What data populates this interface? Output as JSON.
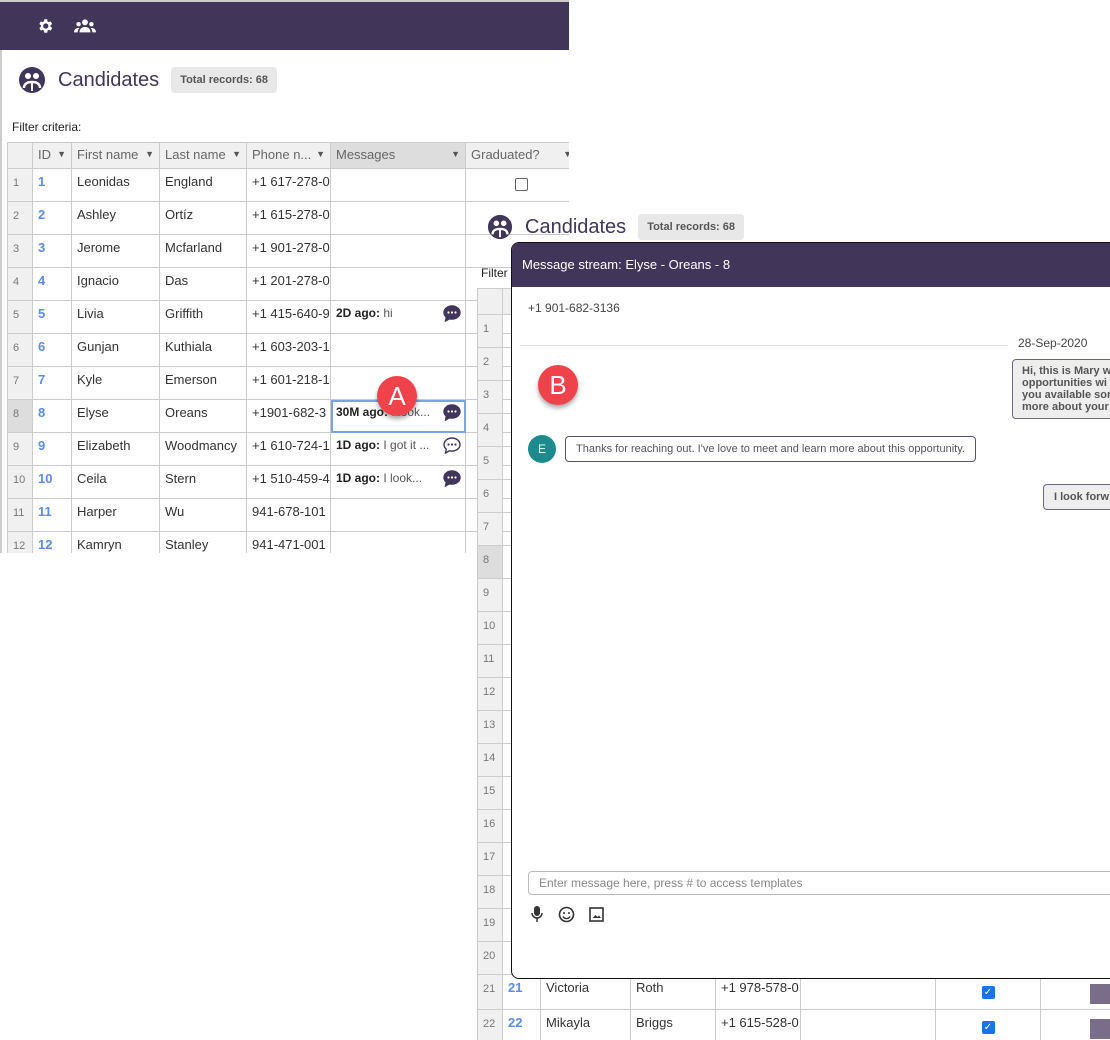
{
  "colors": {
    "brand": "#42355a",
    "link": "#5b8de8",
    "marker": "#f0424a",
    "avatar": "#1d8a8e"
  },
  "topbar": {
    "icons": [
      "gear-icon",
      "people-icon"
    ]
  },
  "page": {
    "title": "Candidates",
    "total_records": "Total records: 68",
    "filter_label": "Filter criteria:"
  },
  "table": {
    "columns": [
      "ID",
      "First name",
      "Last name",
      "Phone n...",
      "Messages",
      "Graduated?"
    ],
    "rows": [
      {
        "n": "1",
        "id": "1",
        "first": "Leonidas",
        "last": "England",
        "phone": "+1 617-278-0",
        "msg_time": "",
        "msg_text": ""
      },
      {
        "n": "2",
        "id": "2",
        "first": "Ashley",
        "last": "Ortíz",
        "phone": "+1 615-278-0",
        "msg_time": "",
        "msg_text": ""
      },
      {
        "n": "3",
        "id": "3",
        "first": "Jerome",
        "last": "Mcfarland",
        "phone": "+1 901-278-0",
        "msg_time": "",
        "msg_text": ""
      },
      {
        "n": "4",
        "id": "4",
        "first": "Ignacio",
        "last": "Das",
        "phone": "+1 201-278-0",
        "msg_time": "",
        "msg_text": ""
      },
      {
        "n": "5",
        "id": "5",
        "first": "Livia",
        "last": "Griffith",
        "phone": "+1 415-640-9",
        "msg_time": "2D ago:",
        "msg_text": " hi"
      },
      {
        "n": "6",
        "id": "6",
        "first": "Gunjan",
        "last": "Kuthiala",
        "phone": "+1 603-203-1",
        "msg_time": "",
        "msg_text": ""
      },
      {
        "n": "7",
        "id": "7",
        "first": "Kyle",
        "last": "Emerson",
        "phone": "+1 601-218-1",
        "msg_time": "",
        "msg_text": ""
      },
      {
        "n": "8",
        "id": "8",
        "first": "Elyse",
        "last": "Oreans",
        "phone": "+1901-682-3",
        "msg_time": "30M  ago:",
        "msg_text": " I look..."
      },
      {
        "n": "9",
        "id": "9",
        "first": "Elizabeth",
        "last": "Woodmancy",
        "phone": "+1 610-724-1",
        "msg_time": "1D  ago:",
        "msg_text": " I got it ..."
      },
      {
        "n": "10",
        "id": "10",
        "first": "Ceila",
        "last": "Stern",
        "phone": "+1 510-459-4",
        "msg_time": "1D     ago:",
        "msg_text": " I look..."
      },
      {
        "n": "11",
        "id": "11",
        "first": "Harper",
        "last": "Wu",
        "phone": "941-678-101",
        "msg_time": "",
        "msg_text": ""
      },
      {
        "n": "12",
        "id": "12",
        "first": "Kamryn",
        "last": "Stanley",
        "phone": "941-471-001",
        "msg_time": "",
        "msg_text": ""
      }
    ]
  },
  "back_table": {
    "filter_label": "Filter",
    "rows": [
      {
        "n": "21",
        "id": "21",
        "first": "Victoria",
        "last": "Roth",
        "phone": "+1 978-578-0",
        "graduated": true
      },
      {
        "n": "22",
        "id": "22",
        "first": "Mikayla",
        "last": "Briggs",
        "phone": "+1 615-528-0",
        "graduated": true
      }
    ],
    "row_numbers": [
      "1",
      "2",
      "3",
      "4",
      "5",
      "6",
      "7",
      "8",
      "9",
      "10",
      "11",
      "12",
      "13",
      "14",
      "15",
      "16",
      "17",
      "18",
      "19",
      "20"
    ]
  },
  "markers": {
    "a": "A",
    "b": "B"
  },
  "modal": {
    "title": "Message stream: Elyse - Oreans - 8",
    "phone": "+1 901-682-3136",
    "date": "28-Sep-2020",
    "outgoing_1": [
      "Hi, this is Mary w",
      "opportunities wi",
      "you available sor",
      "more about your"
    ],
    "incoming_1": "Thanks for reaching out. I've love to meet and learn more about this opportunity.",
    "avatar_initial": "E",
    "outgoing_2": "I look forw",
    "input_placeholder": "Enter message here, press # to access templates",
    "tools": [
      "microphone-icon",
      "emoji-icon",
      "image-icon"
    ]
  }
}
